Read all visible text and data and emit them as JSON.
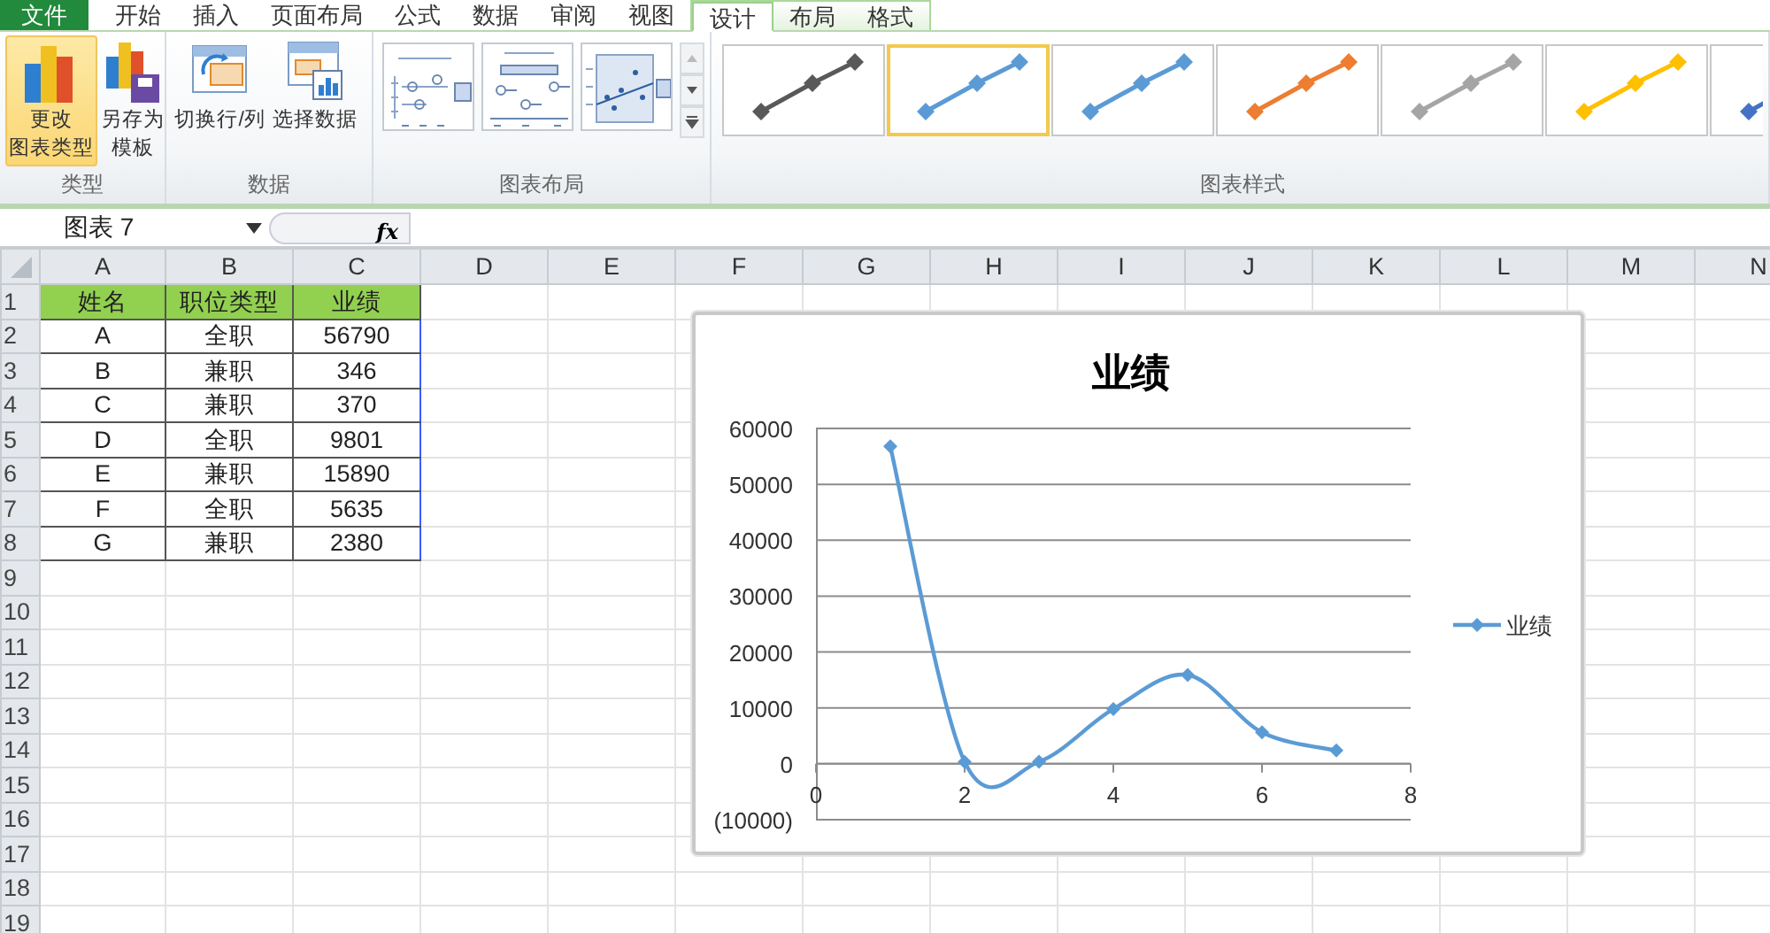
{
  "ribbon_tabs": [
    {
      "label": "文件",
      "kind": "file",
      "selected": false
    },
    {
      "label": "开始",
      "kind": "normal",
      "selected": false
    },
    {
      "label": "插入",
      "kind": "normal",
      "selected": false
    },
    {
      "label": "页面布局",
      "kind": "normal",
      "selected": false
    },
    {
      "label": "公式",
      "kind": "normal",
      "selected": false
    },
    {
      "label": "数据",
      "kind": "normal",
      "selected": false
    },
    {
      "label": "审阅",
      "kind": "normal",
      "selected": false
    },
    {
      "label": "视图",
      "kind": "normal",
      "selected": false
    },
    {
      "label": "设计",
      "kind": "contextual",
      "selected": true
    },
    {
      "label": "布局",
      "kind": "contextual",
      "selected": false
    },
    {
      "label": "格式",
      "kind": "contextual",
      "selected": false
    }
  ],
  "ribbon_groups": [
    {
      "label": "类型",
      "kind": "buttons",
      "buttons": [
        {
          "lines": [
            "更改",
            "图表类型"
          ],
          "highlighted": true
        },
        {
          "lines": [
            "另存为",
            "模板"
          ],
          "highlighted": false
        }
      ]
    },
    {
      "label": "数据",
      "kind": "buttons",
      "buttons": [
        {
          "lines": [
            "切换行/列"
          ],
          "highlighted": false
        },
        {
          "lines": [
            "选择数据"
          ],
          "highlighted": false
        }
      ]
    },
    {
      "label": "图表布局",
      "kind": "layouts",
      "layouts": [
        {
          "kind": "legend-right"
        },
        {
          "kind": "title-top"
        },
        {
          "kind": "scatter-grid"
        }
      ]
    },
    {
      "label": "图表样式",
      "kind": "styles",
      "styles": [
        {
          "color": "#595959",
          "selected": false
        },
        {
          "color": "#5b9bd5",
          "selected": true
        },
        {
          "color": "#5b9bd5",
          "selected": false
        },
        {
          "color": "#ed7d31",
          "selected": false
        },
        {
          "color": "#a5a5a5",
          "selected": false
        },
        {
          "color": "#ffc000",
          "selected": false
        },
        {
          "color": "#4472c4",
          "selected": false
        }
      ]
    }
  ],
  "formula_bar": {
    "name_box": "图表 7",
    "fx": "fx"
  },
  "sheet": {
    "columns": [
      "A",
      "B",
      "C",
      "D",
      "E",
      "F",
      "G",
      "H",
      "I",
      "J",
      "K",
      "L",
      "M",
      "N"
    ],
    "row_numbers": [
      "1",
      "2",
      "3",
      "4",
      "5",
      "6",
      "7",
      "8",
      "9",
      "10",
      "11",
      "12",
      "13",
      "14",
      "15",
      "16",
      "17",
      "18",
      "19"
    ],
    "header": [
      "姓名",
      "职位类型",
      "业绩"
    ],
    "rows": [
      [
        "A",
        "全职",
        "56790"
      ],
      [
        "B",
        "兼职",
        "346"
      ],
      [
        "C",
        "兼职",
        "370"
      ],
      [
        "D",
        "全职",
        "9801"
      ],
      [
        "E",
        "兼职",
        "15890"
      ],
      [
        "F",
        "全职",
        "5635"
      ],
      [
        "G",
        "兼职",
        "2380"
      ]
    ]
  },
  "chart": {
    "chart_data": {
      "type": "line",
      "title": "业绩",
      "x": [
        1,
        2,
        3,
        4,
        5,
        6,
        7
      ],
      "grid": true,
      "series": [
        {
          "name": "业绩",
          "color": "#5b9bd5",
          "marker": "diamond",
          "values": [
            56790,
            346,
            370,
            9801,
            15890,
            5635,
            2380
          ]
        }
      ],
      "xlim": [
        0,
        8
      ],
      "ylim": [
        -10000,
        60000
      ],
      "xticks": [
        0,
        2,
        4,
        6,
        8
      ],
      "yticks": [
        {
          "value": -10000,
          "label": "(10000)"
        },
        0,
        10000,
        20000,
        30000,
        40000,
        50000,
        60000
      ]
    }
  }
}
